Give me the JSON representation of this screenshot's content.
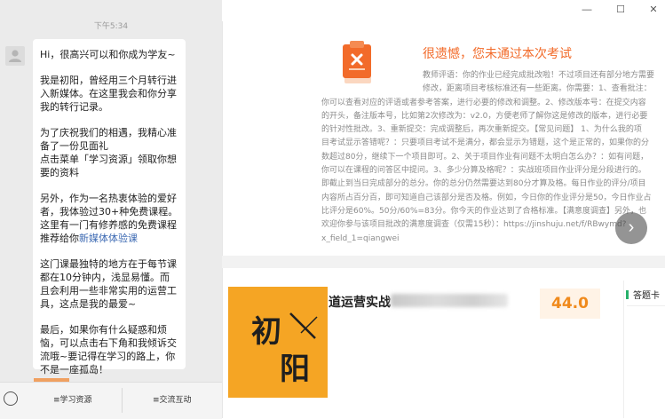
{
  "chat": {
    "time": "下午5:34",
    "message": {
      "p1": "Hi，很高兴可以和你成为学友~",
      "p2": "我是初阳，曾经用三个月转行进入新媒体。在这里我会和你分享我的转行记录。",
      "p3": "为了庆祝我们的相遇，我精心准备了一份见面礼",
      "p4": "点击菜单「学习资源」领取你想要的资料",
      "p5a": "另外，作为一名热衷体验的爱好者，我体验过30+种免费课程。这里有一门有修养感的免费课程推荐给你",
      "p5link": "新媒体体验课",
      "p6": "这门课最独特的地方在于每节课都在10分钟内，浅显易懂。而且会利用一些非常实用的运营工具，这点是我的最爱~",
      "p7": "最后，如果你有什么疑惑和烦恼，可以点击右下角和我倾诉交流哦~要记得在学习的路上，你不是一座孤岛！"
    },
    "menu": {
      "left": "≡学习资源",
      "right": "≡交流互动"
    }
  },
  "window": {
    "minimize": "—",
    "maximize": "☐",
    "close": "✕"
  },
  "result": {
    "title": "很遗憾，您未通过本次考试",
    "comment_lines": [
      "教师评语：你的作业已经完成批改啦！不过项目还有部分地方需要",
      "修改，距离项目考核标准还有一些距离。你需要：1、查看批注：",
      "你可以查看对应的评语或者参考答案，进行必要的修改和调整。2、修改版本号：在提交内容",
      "的开头，备注版本号，比如第2次修改为：v2.0，方便老师了解你这是修改的版本，进行必要",
      "的针对性批改。3、重新提交：完成调整后，再次重新提交。【常见问题】 1、为什么我的项",
      "目考试显示答错呢？：只要项目考试不是满分，都会显示为错题，这个是正常的，如果你的分",
      "数超过80分，继续下一个项目即可。2、关于项目作业有问题不太明白怎么办？：如有问题，",
      "你可以在课程的问答区中提问。3、多少分算及格呢？：实战班项目作业评分是分段进行的。",
      "即截止到当日完成部分的总分。你的总分仍然需要达到80分才算及格。每日作业的评分/项目",
      "内容所占百分百，即可知道自己该部分是否及格。例如，今日你的作业评分是50，今日作业占",
      "比评分是60%。50分/60%=83分。你今天的作业达到了合格标准。【满意度调查】另外，也",
      "欢迎你参与该项目批改的满意度调查（仅需15秒）：https://jinshuju.net/f/RBwymd?",
      "x_field_1=qiangwei"
    ],
    "next_arrow": "›"
  },
  "course": {
    "name": "道运营实战",
    "score": "44.0",
    "thumb_text": [
      "初",
      "阳"
    ],
    "answer_card": "答题卡"
  }
}
